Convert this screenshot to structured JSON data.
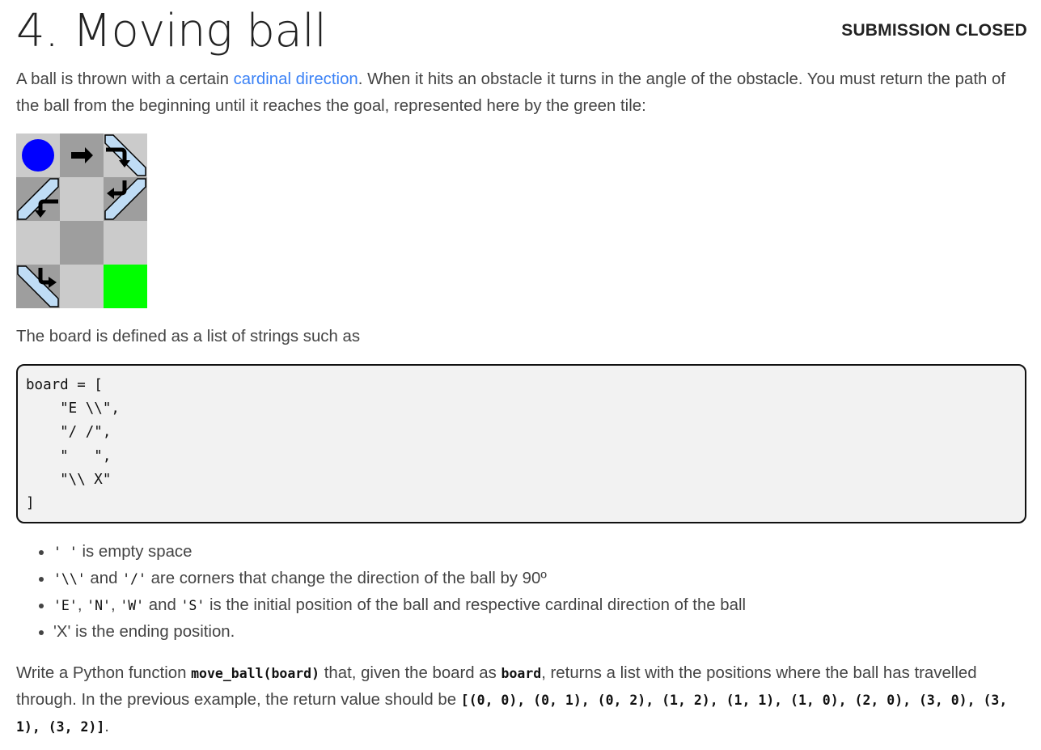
{
  "header": {
    "title": "4. Moving ball",
    "status": "SUBMISSION CLOSED"
  },
  "intro": {
    "text_before_link": "A ball is thrown with a certain ",
    "link": "cardinal direction",
    "text_after_link": ". When it hits an obstacle it turns in the angle of the obstacle. You must return the path of the ball from the beginning until it reaches the goal, represented here by the green tile:"
  },
  "board_image": {
    "rows": 4,
    "cols": 3,
    "tiles": [
      {
        "shade": "light",
        "content": "ball"
      },
      {
        "shade": "dark",
        "content": "arrow-right"
      },
      {
        "shade": "light",
        "content": "backslash-turn-down"
      },
      {
        "shade": "dark",
        "content": "slash-turn-down"
      },
      {
        "shade": "light",
        "content": "empty"
      },
      {
        "shade": "dark",
        "content": "slash-turn-left"
      },
      {
        "shade": "light",
        "content": "empty"
      },
      {
        "shade": "dark",
        "content": "empty"
      },
      {
        "shade": "light",
        "content": "empty"
      },
      {
        "shade": "dark",
        "content": "backslash-turn-right"
      },
      {
        "shade": "light",
        "content": "empty"
      },
      {
        "shade": "goal",
        "content": "empty"
      }
    ],
    "colors": {
      "ball": "#0000ff",
      "goal": "#00ff00",
      "light": "#cbcbcb",
      "dark": "#9e9e9e",
      "mirror": "#bfdcf5"
    }
  },
  "board_definition_text": "The board is defined as a list of strings such as",
  "code_block": "board = [\n    \"E \\\\\",\n    \"/ /\",\n    \"   \",\n    \"\\\\ X\"\n]",
  "bullets": [
    {
      "code": "' '",
      "text": " is empty space"
    },
    {
      "code1": "'\\\\'",
      "mid": " and ",
      "code2": "'/'",
      "text": " are corners that change the direction of the ball by 90º"
    },
    {
      "c1": "'E'",
      "s1": ", ",
      "c2": "'N'",
      "s2": ", ",
      "c3": "'W'",
      "s3": " and ",
      "c4": "'S'",
      "text": " is the initial position of the ball and respective cardinal direction of the ball"
    },
    {
      "text": "'X' is the ending position."
    }
  ],
  "task": {
    "t1": "Write a Python function ",
    "func": "move_ball(board)",
    "t2": " that, given the board as ",
    "arg": "board",
    "t3": ", returns a list with the positions where the ball has travelled through. In the previous example, the return value should be ",
    "result": "[(0, 0), (0, 1), (0, 2), (1, 2), (1, 1), (1, 0), (2, 0), (3, 0), (3, 1), (3, 2)]",
    "t4": "."
  }
}
